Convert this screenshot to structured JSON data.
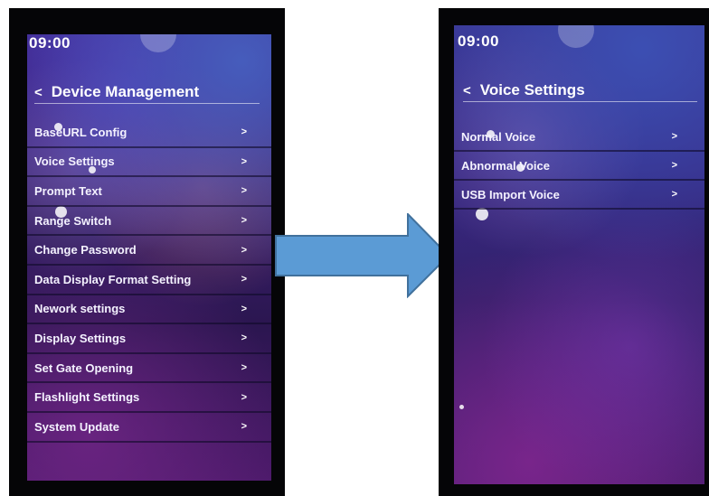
{
  "left_screen": {
    "time": "09:00",
    "back_icon": "<",
    "title": "Device Management",
    "items": [
      {
        "label": "BaseURL Config",
        "chevron": ">"
      },
      {
        "label": "Voice Settings",
        "chevron": ">"
      },
      {
        "label": "Prompt Text",
        "chevron": ">"
      },
      {
        "label": "Range Switch",
        "chevron": ">"
      },
      {
        "label": "Change Password",
        "chevron": ">"
      },
      {
        "label": "Data Display Format Setting",
        "chevron": ">"
      },
      {
        "label": "Nework settings",
        "chevron": ">"
      },
      {
        "label": "Display Settings",
        "chevron": ">"
      },
      {
        "label": "Set Gate Opening",
        "chevron": ">"
      },
      {
        "label": "Flashlight Settings",
        "chevron": ">"
      },
      {
        "label": "System Update",
        "chevron": ">"
      }
    ]
  },
  "right_screen": {
    "time": "09:00",
    "back_icon": "<",
    "title": "Voice Settings",
    "items": [
      {
        "label": "Normal Voice",
        "chevron": ">"
      },
      {
        "label": "Abnormal Voice",
        "chevron": ">"
      },
      {
        "label": "USB Import Voice",
        "chevron": ">"
      }
    ]
  },
  "transition_arrow": {
    "icon": "right-arrow-icon",
    "color": "#5b9bd5"
  }
}
